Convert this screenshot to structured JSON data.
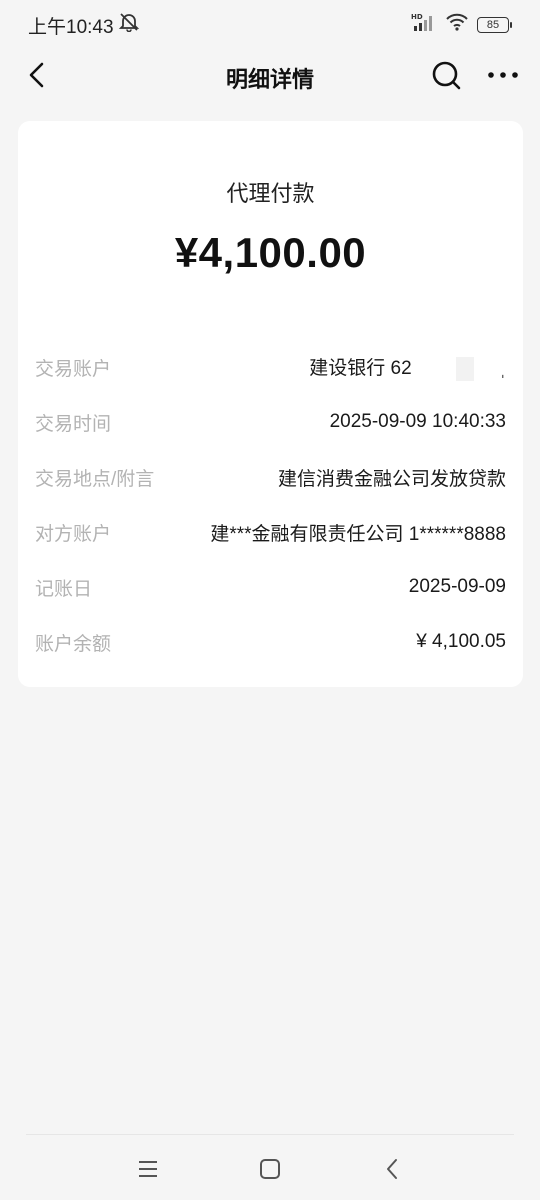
{
  "status_bar": {
    "time": "上午10:43",
    "battery": "85",
    "icons": [
      "mute-icon",
      "signal-icon",
      "wifi-icon",
      "battery-icon"
    ]
  },
  "nav": {
    "title": "明细详情",
    "icons": [
      "back-icon",
      "search-icon",
      "more-icon"
    ]
  },
  "transaction": {
    "type": "代理付款",
    "amount": "¥4,100.00",
    "details": [
      {
        "label": "交易账户",
        "value": "建设银行 62"
      },
      {
        "label": "交易时间",
        "value": "2025-09-09 10:40:33"
      },
      {
        "label": "交易地点/附言",
        "value": "建信消费金融公司发放贷款"
      },
      {
        "label": "对方账户",
        "value": "建***金融有限责任公司 1******8888"
      },
      {
        "label": "记账日",
        "value": "2025-09-09"
      },
      {
        "label": "账户余额",
        "value": "¥ 4,100.05"
      }
    ]
  },
  "system_nav": {
    "icons": [
      "menu-icon",
      "home-icon",
      "back-nav-icon"
    ]
  }
}
